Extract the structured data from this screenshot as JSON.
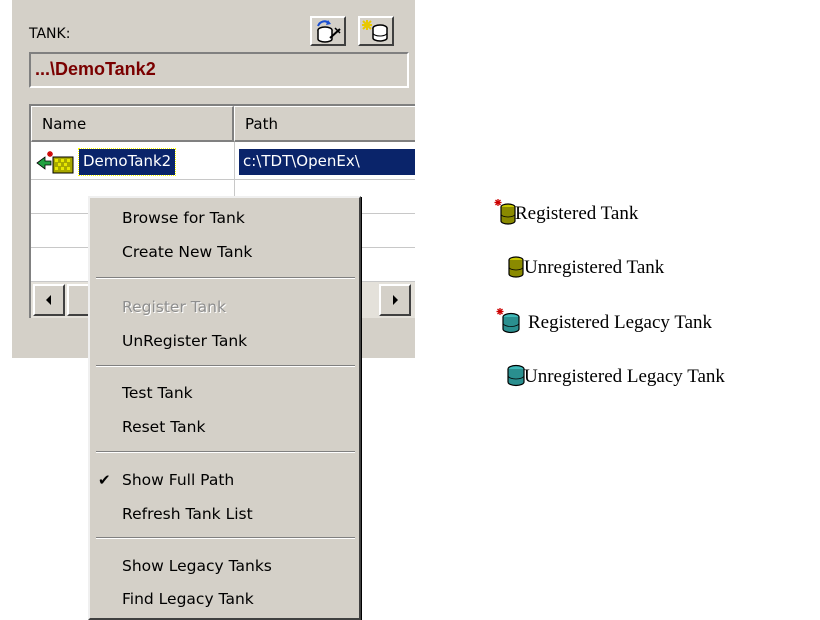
{
  "panel": {
    "tank_label": "TANK:",
    "tank_path": "...\\DemoTank2",
    "columns": [
      "Name",
      "Path"
    ],
    "rows": [
      {
        "name": "DemoTank2",
        "path": "c:\\TDT\\OpenEx\\"
      }
    ]
  },
  "menu": {
    "items": [
      {
        "label": "Browse for Tank",
        "enabled": true,
        "checked": false
      },
      {
        "label": "Create New Tank",
        "enabled": true,
        "checked": false
      },
      {
        "label": "Register Tank",
        "enabled": false,
        "checked": false
      },
      {
        "label": "UnRegister Tank",
        "enabled": true,
        "checked": false
      },
      {
        "label": "Test Tank",
        "enabled": true,
        "checked": false
      },
      {
        "label": "Reset Tank",
        "enabled": true,
        "checked": false
      },
      {
        "label": "Show Full Path",
        "enabled": true,
        "checked": true
      },
      {
        "label": "Refresh Tank List",
        "enabled": true,
        "checked": false
      },
      {
        "label": "Show Legacy Tanks",
        "enabled": true,
        "checked": false
      },
      {
        "label": "Find Legacy Tank",
        "enabled": true,
        "checked": false
      }
    ],
    "check_glyph": "✔"
  },
  "legend": [
    {
      "label": "Registered Tank",
      "icon": "registered-tank-icon"
    },
    {
      "label": "Unregistered Tank",
      "icon": "unregistered-tank-icon"
    },
    {
      "label": "Registered Legacy Tank",
      "icon": "registered-legacy-tank-icon"
    },
    {
      "label": "Unregistered Legacy Tank",
      "icon": "unregistered-legacy-tank-icon"
    }
  ],
  "colors": {
    "selection": "#0a246a",
    "tank_path_text": "#7a0000",
    "tank_olive": "#8a8a00",
    "legacy_teal": "#2a8f8f",
    "registered_star": "#cc0000"
  }
}
